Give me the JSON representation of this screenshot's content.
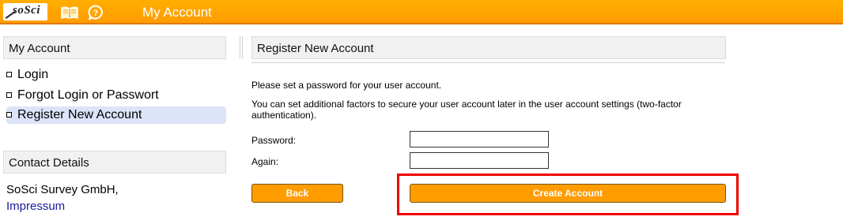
{
  "header": {
    "logo_text": "soSci",
    "book_icon": "book-icon",
    "help_icon": "help-bubble-icon",
    "title": "My Account"
  },
  "sidebar": {
    "title": "My Account",
    "items": [
      {
        "label": "Login",
        "active": false
      },
      {
        "label": "Forgot Login or Passwort",
        "active": false
      },
      {
        "label": "Register New Account",
        "active": true
      }
    ],
    "contact": {
      "title": "Contact Details",
      "company": "SoSci Survey GmbH,",
      "link": "Impressum"
    }
  },
  "main": {
    "title": "Register New Account",
    "intro": "Please set a password for your user account.",
    "note": "You can set additional factors to secure your user account later in the user account settings (two-factor authentication).",
    "password_label": "Password:",
    "password_value": "",
    "again_label": "Again:",
    "again_value": "",
    "back_label": "Back",
    "create_label": "Create Account"
  },
  "colors": {
    "accent": "#ff9c00",
    "highlight": "#ee0000",
    "active_item": "#dde3f8",
    "link": "#1a1a9c"
  }
}
